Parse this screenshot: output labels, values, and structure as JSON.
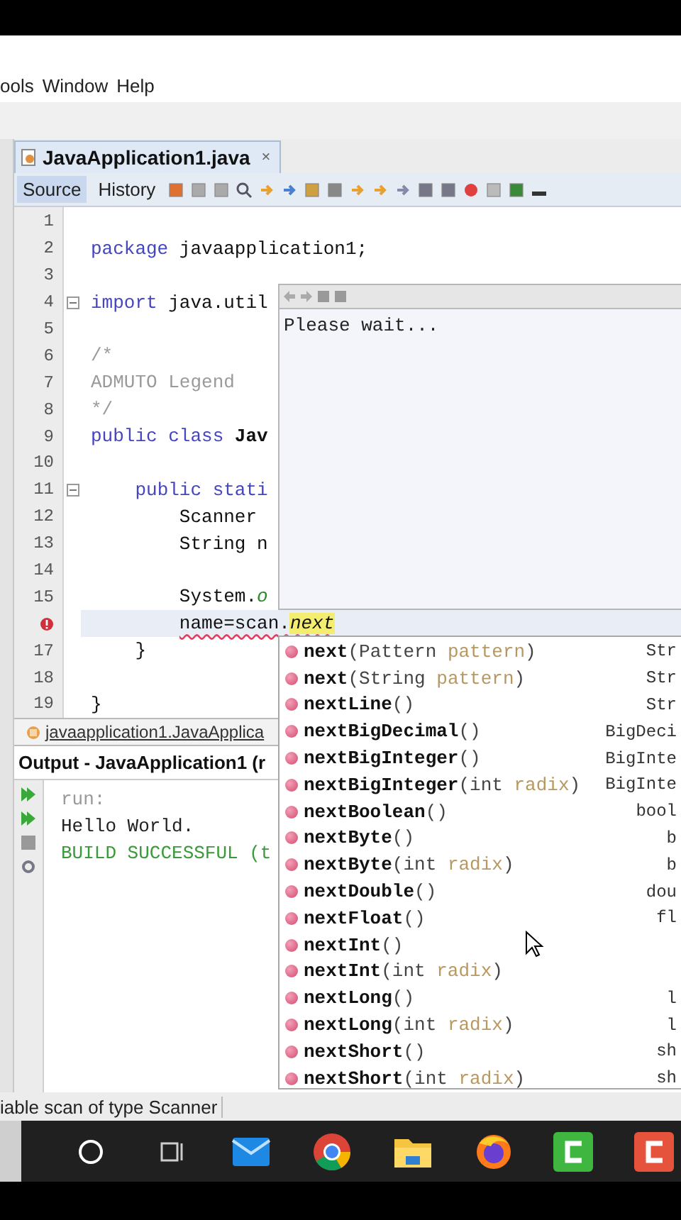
{
  "menu": [
    "ools",
    "Window",
    "Help"
  ],
  "file_tab": {
    "title": "JavaApplication1.java",
    "close": "×",
    "selected": true
  },
  "editor_tabs": [
    {
      "label": "Source",
      "selected": true
    },
    {
      "label": "History",
      "selected": false
    }
  ],
  "code_lines": [
    {
      "number": "1"
    },
    {
      "number": "2",
      "segments": [
        {
          "text": "package",
          "kind": "keyword"
        },
        {
          "text": " javaapplication1;",
          "kind": "plain"
        }
      ]
    },
    {
      "number": "3"
    },
    {
      "number": "4",
      "fold": true,
      "segments": [
        {
          "text": "import",
          "kind": "keyword"
        },
        {
          "text": " java.util",
          "kind": "plain"
        }
      ]
    },
    {
      "number": "5"
    },
    {
      "number": "6",
      "segments": [
        {
          "text": "/*",
          "kind": "comment"
        }
      ]
    },
    {
      "number": "7",
      "segments": [
        {
          "text": "ADMUTO Legend",
          "kind": "comment"
        }
      ]
    },
    {
      "number": "8",
      "segments": [
        {
          "text": "*/",
          "kind": "comment"
        }
      ]
    },
    {
      "number": "9",
      "segments": [
        {
          "text": "public class ",
          "kind": "keyword"
        },
        {
          "text": "Jav",
          "kind": "bold"
        }
      ]
    },
    {
      "number": "10"
    },
    {
      "number": "11",
      "fold": true,
      "segments": [
        {
          "text": "    public stati",
          "kind": "keyword"
        }
      ]
    },
    {
      "number": "12",
      "segments": [
        {
          "text": "        Scanner",
          "kind": "plain"
        }
      ]
    },
    {
      "number": "13",
      "segments": [
        {
          "text": "        String n",
          "kind": "plain"
        }
      ]
    },
    {
      "number": "14"
    },
    {
      "number": "15",
      "segments": [
        {
          "text": "        System.",
          "kind": "plain"
        },
        {
          "text": "o",
          "kind": "static"
        }
      ]
    },
    {
      "error": true,
      "current": true,
      "segments": [
        {
          "text": "        name=scan.",
          "kind": "error"
        },
        {
          "text": "next",
          "kind": "match"
        }
      ]
    },
    {
      "number": "17",
      "segments": [
        {
          "text": "    }",
          "kind": "plain"
        }
      ]
    },
    {
      "number": "18"
    },
    {
      "number": "19",
      "segments": [
        {
          "text": "}",
          "kind": "plain"
        }
      ]
    }
  ],
  "javadoc_popup": {
    "message": "Please wait..."
  },
  "completions": [
    {
      "name": "next",
      "params": [
        {
          "text": "(Pattern "
        },
        {
          "text": "pattern",
          "kind": "param"
        },
        {
          "text": ")"
        }
      ],
      "returns": "Str"
    },
    {
      "name": "next",
      "params": [
        {
          "text": "(String "
        },
        {
          "text": "pattern",
          "kind": "param"
        },
        {
          "text": ")"
        }
      ],
      "returns": "Str"
    },
    {
      "name": "nextLine",
      "params": [
        {
          "text": "()"
        }
      ],
      "returns": "Str"
    },
    {
      "name": "nextBigDecimal",
      "params": [
        {
          "text": "()"
        }
      ],
      "returns": "BigDeci"
    },
    {
      "name": "nextBigInteger",
      "params": [
        {
          "text": "()"
        }
      ],
      "returns": "BigInte"
    },
    {
      "name": "nextBigInteger",
      "params": [
        {
          "text": "(int "
        },
        {
          "text": "radix",
          "kind": "param"
        },
        {
          "text": ")"
        }
      ],
      "returns": "BigInte"
    },
    {
      "name": "nextBoolean",
      "params": [
        {
          "text": "()"
        }
      ],
      "returns": "bool"
    },
    {
      "name": "nextByte",
      "params": [
        {
          "text": "()"
        }
      ],
      "returns": "b"
    },
    {
      "name": "nextByte",
      "params": [
        {
          "text": "(int "
        },
        {
          "text": "radix",
          "kind": "param"
        },
        {
          "text": ")"
        }
      ],
      "returns": "b"
    },
    {
      "name": "nextDouble",
      "params": [
        {
          "text": "()"
        }
      ],
      "returns": "dou"
    },
    {
      "name": "nextFloat",
      "params": [
        {
          "text": "()"
        }
      ],
      "returns": "fl"
    },
    {
      "name": "nextInt",
      "params": [
        {
          "text": "()"
        }
      ]
    },
    {
      "name": "nextInt",
      "params": [
        {
          "text": "(int "
        },
        {
          "text": "radix",
          "kind": "param"
        },
        {
          "text": ")"
        }
      ]
    },
    {
      "name": "nextLong",
      "params": [
        {
          "text": "()"
        }
      ],
      "returns": "l"
    },
    {
      "name": "nextLong",
      "params": [
        {
          "text": "(int "
        },
        {
          "text": "radix",
          "kind": "param"
        },
        {
          "text": ")"
        }
      ],
      "returns": "l"
    },
    {
      "name": "nextShort",
      "params": [
        {
          "text": "()"
        }
      ],
      "returns": "sh"
    },
    {
      "name": "nextShort",
      "params": [
        {
          "text": "(int "
        },
        {
          "text": "radix",
          "kind": "param"
        },
        {
          "text": ")"
        }
      ],
      "returns": "sh"
    }
  ],
  "navigator": "javaapplication1.JavaApplica",
  "output": {
    "title": "Output - JavaApplication1 (r",
    "lines": [
      {
        "text": "run:",
        "kind": "muted"
      },
      {
        "text": "Hello World.",
        "kind": "plain"
      },
      {
        "text": "BUILD SUCCESSFUL (t",
        "kind": "success"
      }
    ]
  },
  "status_bar": "iable scan of type Scanner",
  "taskbar": [
    {
      "kind": "search"
    },
    {
      "kind": "taskview"
    },
    {
      "kind": "mail"
    },
    {
      "kind": "chrome"
    },
    {
      "kind": "folder"
    },
    {
      "kind": "firefox"
    },
    {
      "kind": "green-app"
    },
    {
      "kind": "red-app"
    }
  ]
}
